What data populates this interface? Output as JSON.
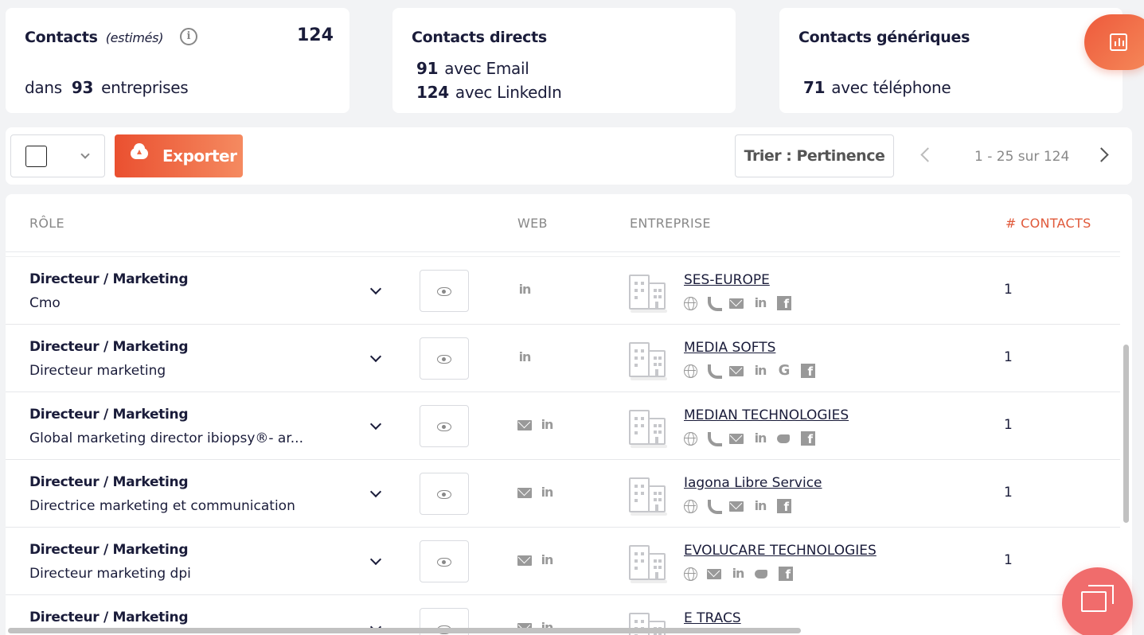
{
  "summary": {
    "contacts": {
      "title": "Contacts",
      "qualifier": "(estimés)",
      "total": "124",
      "companies_prefix": "dans",
      "companies_count": "93",
      "companies_suffix": "entreprises"
    },
    "direct": {
      "title": "Contacts directs",
      "email_count": "91",
      "email_label": "avec Email",
      "linkedin_count": "124",
      "linkedin_label": "avec LinkedIn"
    },
    "generic": {
      "title": "Contacts génériques",
      "phone_count": "71",
      "phone_label": "avec téléphone"
    }
  },
  "toolbar": {
    "export_label": "Exporter",
    "sort_label": "Trier : Pertinence",
    "pagination": "1 - 25 sur 124"
  },
  "table": {
    "headers": {
      "role": "RÔLE",
      "web": "WEB",
      "company": "ENTREPRISE",
      "contacts": "# CONTACTS"
    },
    "rows": [
      {
        "role": "Directeur / Marketing",
        "title": "Cmo",
        "web_icons": [
          "linkedin-icon"
        ],
        "company": "SES-EUROPE",
        "company_icons": [
          "globe-icon",
          "phone-icon",
          "mail-icon",
          "linkedin-icon",
          "facebook-icon"
        ],
        "count": "1"
      },
      {
        "role": "Directeur / Marketing",
        "title": "Directeur marketing",
        "web_icons": [
          "linkedin-icon"
        ],
        "company": "MEDIA SOFTS",
        "company_icons": [
          "globe-icon",
          "phone-icon",
          "mail-icon",
          "linkedin-icon",
          "google-icon",
          "facebook-icon"
        ],
        "count": "1"
      },
      {
        "role": "Directeur / Marketing",
        "title": "Global marketing director ibiopsy®- ar...",
        "web_icons": [
          "mail-icon",
          "linkedin-icon"
        ],
        "company": "MEDIAN TECHNOLOGIES",
        "company_icons": [
          "globe-icon",
          "phone-icon",
          "mail-icon",
          "linkedin-icon",
          "twitter-icon",
          "facebook-icon"
        ],
        "count": "1"
      },
      {
        "role": "Directeur / Marketing",
        "title": "Directrice marketing et communication",
        "web_icons": [
          "mail-icon",
          "linkedin-icon"
        ],
        "company": "Iagona Libre Service",
        "company_icons": [
          "globe-icon",
          "phone-icon",
          "mail-icon",
          "linkedin-icon",
          "facebook-icon"
        ],
        "count": "1"
      },
      {
        "role": "Directeur / Marketing",
        "title": "Directeur marketing dpi",
        "web_icons": [
          "mail-icon",
          "linkedin-icon"
        ],
        "company": "EVOLUCARE TECHNOLOGIES",
        "company_icons": [
          "globe-icon",
          "mail-icon",
          "linkedin-icon",
          "twitter-icon",
          "facebook-icon"
        ],
        "count": "1"
      },
      {
        "role": "Directeur / Marketing",
        "title": "",
        "web_icons": [
          "mail-icon",
          "linkedin-icon"
        ],
        "company": "E TRACS",
        "company_icons": [],
        "count": ""
      }
    ]
  }
}
